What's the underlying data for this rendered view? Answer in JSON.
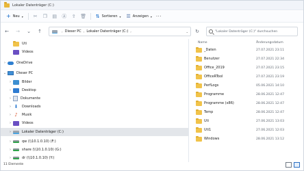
{
  "window": {
    "title": "Lokaler Datenträger (C:)"
  },
  "commandbar": {
    "new_label": "Neu",
    "sort_label": "Sortieren",
    "view_label": "Anzeigen",
    "more_label": "···"
  },
  "address": {
    "crumbs": [
      "Dieser PC",
      "Lokaler Datenträger (C:)"
    ],
    "search_placeholder": "\"Lokaler Datenträger (C:)\" durchsuchen"
  },
  "nav": {
    "items": [
      {
        "label": "Uti",
        "icon": "folder-icon"
      },
      {
        "label": "Videos",
        "icon": "video-icon"
      },
      {
        "label": "OneDrive",
        "icon": "cloud-icon"
      },
      {
        "label": "Dieser PC",
        "icon": "pc-icon"
      },
      {
        "label": "Bilder",
        "icon": "pictures-icon"
      },
      {
        "label": "Desktop",
        "icon": "desktop-icon"
      },
      {
        "label": "Dokumente",
        "icon": "documents-icon"
      },
      {
        "label": "Downloads",
        "icon": "download-icon"
      },
      {
        "label": "Musik",
        "icon": "music-icon"
      },
      {
        "label": "Videos",
        "icon": "video-icon"
      },
      {
        "label": "Lokaler Datenträger (C:)",
        "icon": "drive-icon"
      },
      {
        "label": "qw (\\\\10.1.0.10) (F:)",
        "icon": "network-drive-icon"
      },
      {
        "label": "share (\\\\10.1.0.10) (G:)",
        "icon": "network-drive-icon"
      },
      {
        "label": "dr (\\\\10.1.0.10) (Y:)",
        "icon": "network-drive-icon"
      }
    ]
  },
  "content": {
    "col_name": "Name",
    "col_date": "Änderungsdatum",
    "files": [
      {
        "name": "_Daten",
        "date": "27.07.2021 23:11"
      },
      {
        "name": "Benutzer",
        "date": "27.07.2021 22:34"
      },
      {
        "name": "Office_2019",
        "date": "27.07.2021 23:15"
      },
      {
        "name": "OfficeRTool",
        "date": "27.07.2021 23:19"
      },
      {
        "name": "PerfLogs",
        "date": "05.06.2021 14:10"
      },
      {
        "name": "Programme",
        "date": "28.06.2021 12:47"
      },
      {
        "name": "Programme (x86)",
        "date": "28.06.2021 12:47"
      },
      {
        "name": "Temp",
        "date": "28.06.2021 12:47"
      },
      {
        "name": "Uti",
        "date": "27.06.2021 13:03"
      },
      {
        "name": "Uti1",
        "date": "27.06.2021 12:03"
      },
      {
        "name": "Windows",
        "date": "28.06.2021 13:12"
      }
    ]
  },
  "status": {
    "count": "11 Elemente"
  }
}
